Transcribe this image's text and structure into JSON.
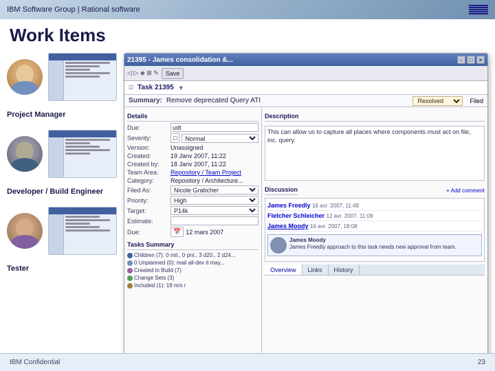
{
  "header": {
    "title": "IBM Software Group | Rational software",
    "logo_alt": "IBM Logo"
  },
  "page": {
    "title": "Work Items"
  },
  "personas": [
    {
      "id": "pm",
      "name": "Project Manager",
      "role": "pm"
    },
    {
      "id": "dev",
      "name": "Developer / Build Engineer",
      "role": "dev"
    },
    {
      "id": "tester",
      "name": "Tester",
      "role": "tester"
    }
  ],
  "dialog": {
    "title": "21395 - James consolidation &...",
    "task_id": "Task 21395",
    "summary_label": "Summary:",
    "summary_value": "Remove deprecated Query ATI",
    "status": "Resolved",
    "toolbar_buttons": [
      "Save"
    ],
    "sections": {
      "details_label": "Details",
      "description_label": "Description",
      "fields": [
        {
          "label": "Due:",
          "value": "udt"
        },
        {
          "label": "Severity:",
          "value": "Normal"
        },
        {
          "label": "Version:",
          "value": "Unassigned"
        },
        {
          "label": "Created:",
          "value": "19 Janv 2007, 11:22"
        },
        {
          "label": "Created by:",
          "value": "18 Janv 2007, 11:22"
        },
        {
          "label": "Team Area:",
          "value": "Repository / Team Project"
        },
        {
          "label": "Category:",
          "value": "Repository / Architecture..."
        },
        {
          "label": "Filed As:",
          "value": "Nicole Grabcher"
        },
        {
          "label": "Priority:",
          "value": "High"
        },
        {
          "label": "Target:",
          "value": "P14k"
        },
        {
          "label": "Estimate:",
          "value": ""
        },
        {
          "label": "Due:",
          "value": "12 mars 2007"
        }
      ],
      "description_text": "This can allow us to capture all places where components must act on file, inc. query.",
      "discussion_items": [
        {
          "author": "James Freedly",
          "date": "16 avr. 2007, 11:49",
          "text": ""
        },
        {
          "author": "Fletcher Schleicher",
          "date": "12 avr. 2007, 11:09",
          "text": ""
        },
        {
          "author": "James Moody",
          "date": "16 avr. 2007, 18:08",
          "text": ""
        }
      ],
      "discussion_card": {
        "name": "James Moody",
        "text": "James Freedly approach to this task needs new approval from team."
      },
      "tasks_label": "Tasks Summary",
      "tasks": [
        "Children (7): 0 mil., 0 pnt., 3 d20., 2 d24...",
        "0 Unplanned (0): mail all-dev it may...",
        "Created in Build (7)",
        "Change Sets (3)",
        "Included (1): 19 m/s r"
      ]
    }
  },
  "tabs": [
    "Overview",
    "Links",
    "History"
  ],
  "footer": {
    "left": "IBM Confidential",
    "right": "23"
  }
}
